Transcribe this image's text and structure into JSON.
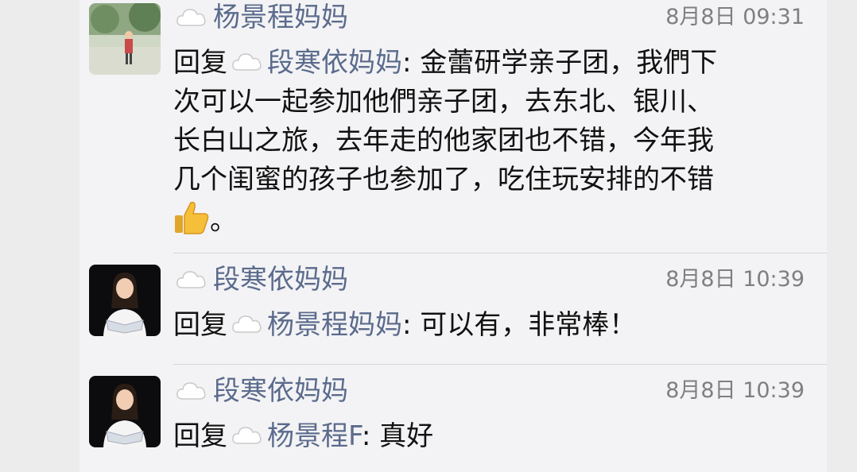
{
  "comments": [
    {
      "author": "杨景程妈妈",
      "time": "8月8日 09:31",
      "reply_prefix": "回复",
      "reply_to": "段寒依妈妈",
      "lines": [
        "次可以一起参加他們亲子团，去东北、银川、",
        "长白山之旅，去年走的他家团也不错，今年我",
        "几个闺蜜的孩子也参加了，吃住玩安排的不错"
      ],
      "first_line_tail": ": 金蕾研学亲子团，我們下",
      "end_text": "。"
    },
    {
      "author": "段寒依妈妈",
      "time": "8月8日 10:39",
      "reply_prefix": "回复",
      "reply_to": "杨景程妈妈",
      "text": ": 可以有，非常棒！"
    },
    {
      "author": "段寒依妈妈",
      "time": "8月8日 10:39",
      "reply_prefix": "回复",
      "reply_to": "杨景程F",
      "text": ": 真好"
    }
  ],
  "icons": {
    "cloud": "cloud-icon",
    "thumb": "thumbs-up-icon"
  },
  "colors": {
    "name": "#5b6b8c",
    "time": "#7f7f7f",
    "background": "#f3f3f5"
  }
}
